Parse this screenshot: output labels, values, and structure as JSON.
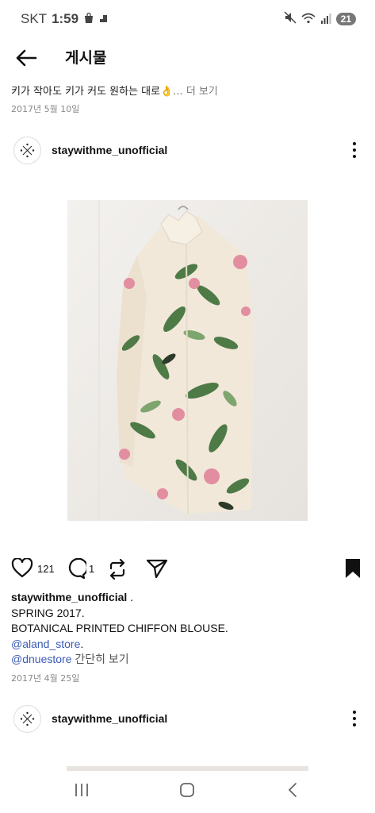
{
  "status_bar": {
    "carrier": "SKT",
    "time": "1:59",
    "battery": "21"
  },
  "header": {
    "title": "게시물"
  },
  "top_caption": {
    "text": "키가 작아도 키가 커도 원하는 대로👌",
    "more": "... 더 보기",
    "date": "2017년 5월 10일"
  },
  "post1": {
    "username": "staywithme_unofficial",
    "likes": "121",
    "comments": "1",
    "caption": {
      "username": "staywithme_unofficial",
      "after_username": " .",
      "line1": "SPRING 2017.",
      "line2": "BOTANICAL PRINTED CHIFFON BLOUSE.",
      "mention1": "@aland_store",
      "mention1_suffix": ".",
      "mention2": "@dnuestore",
      "short_view": " 간단히 보기"
    },
    "date": "2017년 4월 25일"
  },
  "post2": {
    "username": "staywithme_unofficial"
  },
  "icons": {
    "back": "arrow-left-icon",
    "more": "kebab-icon",
    "like": "heart-icon",
    "comment": "comment-icon",
    "repost": "repost-icon",
    "share": "send-icon",
    "save": "bookmark-icon"
  }
}
